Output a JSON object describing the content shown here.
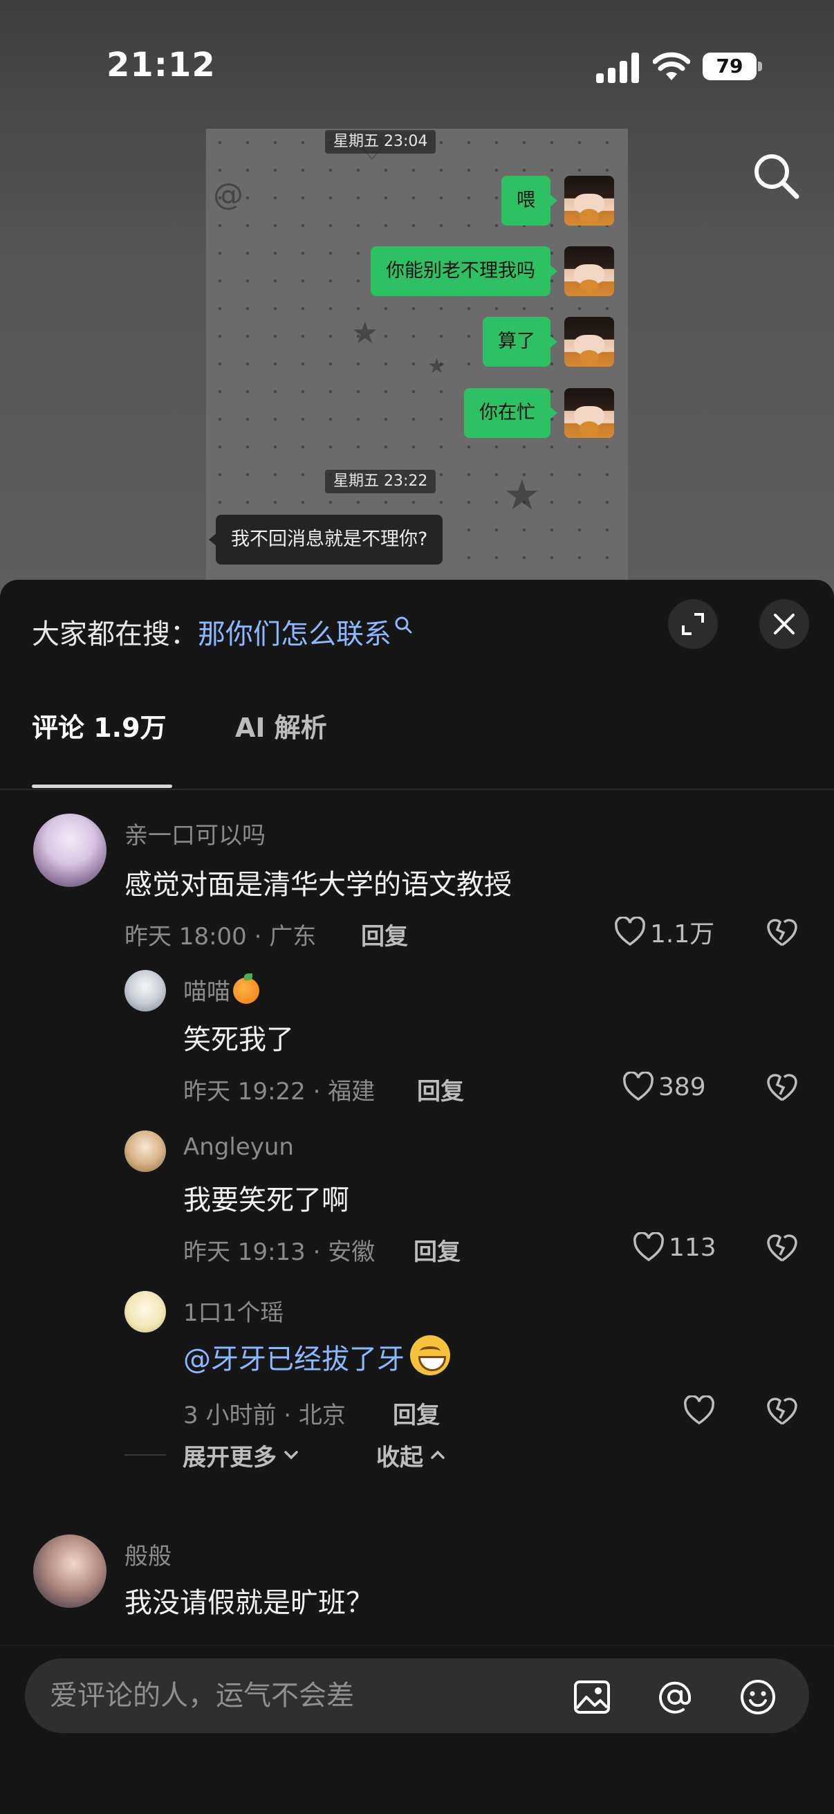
{
  "status_bar": {
    "time": "21:12",
    "battery": "79"
  },
  "chat_screenshot": {
    "timestamp_1": "星期五 23:04",
    "timestamp_2": "星期五 23:22",
    "outgoing": [
      "喂",
      "你能别老不理我吗",
      "算了",
      "你在忙"
    ],
    "incoming": [
      "我不回消息就是不理你?"
    ]
  },
  "hot_search": {
    "label": "大家都在搜：",
    "keyword": "那你们怎么联系"
  },
  "tabs": [
    {
      "label": "评论 1.9万"
    },
    {
      "label": "AI 解析"
    }
  ],
  "comments": [
    {
      "username": "亲一口可以吗",
      "text": "感觉对面是清华大学的语文教授",
      "meta": "昨天 18:00 · 广东",
      "reply": "回复",
      "likes": "1.1万"
    },
    {
      "username": "喵喵",
      "text": "笑死我了",
      "meta": "昨天 19:22 · 福建",
      "reply": "回复",
      "likes": "389"
    },
    {
      "username": "Angleyun",
      "text": "我要笑死了啊",
      "meta": "昨天 19:13 · 安徽",
      "reply": "回复",
      "likes": "113"
    },
    {
      "username": "1口1个瑶",
      "text": "@牙牙已经拔了牙",
      "meta": "3 小时前 · 北京",
      "reply": "回复",
      "likes": ""
    },
    {
      "username": "般般",
      "text": "我没请假就是旷班？",
      "meta": "",
      "reply": "",
      "likes": ""
    }
  ],
  "expand": {
    "more": "展开更多",
    "collapse": "收起"
  },
  "input": {
    "placeholder": "爱评论的人，运气不会差"
  },
  "colors": {
    "accent_blue": "#8cb8ff",
    "wechat_green": "#2dc163",
    "sheet_bg": "#161616"
  }
}
